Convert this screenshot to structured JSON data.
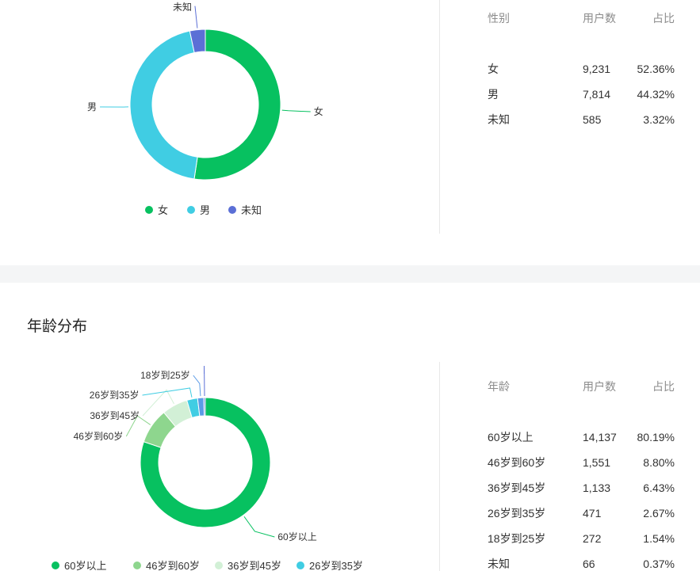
{
  "gender": {
    "table": {
      "headers": [
        "性别",
        "用户数",
        "占比"
      ],
      "rows": [
        {
          "label": "女",
          "users": "9,231",
          "pct": "52.36%"
        },
        {
          "label": "男",
          "users": "7,814",
          "pct": "44.32%"
        },
        {
          "label": "未知",
          "users": "585",
          "pct": "3.32%"
        }
      ]
    }
  },
  "age": {
    "title": "年龄分布",
    "table": {
      "headers": [
        "年龄",
        "用户数",
        "占比"
      ],
      "rows": [
        {
          "label": "60岁以上",
          "users": "14,137",
          "pct": "80.19%"
        },
        {
          "label": "46岁到60岁",
          "users": "1,551",
          "pct": "8.80%"
        },
        {
          "label": "36岁到45岁",
          "users": "1,133",
          "pct": "6.43%"
        },
        {
          "label": "26岁到35岁",
          "users": "471",
          "pct": "2.67%"
        },
        {
          "label": "18岁到25岁",
          "users": "272",
          "pct": "1.54%"
        },
        {
          "label": "未知",
          "users": "66",
          "pct": "0.37%"
        }
      ]
    }
  },
  "chart_data": [
    {
      "type": "pie",
      "title": "",
      "categories": [
        "女",
        "男",
        "未知"
      ],
      "values": [
        9231,
        7814,
        585
      ],
      "colors": [
        "#07c160",
        "#40cde3",
        "#5b6fd6"
      ],
      "legend": "bottom-center",
      "legend_items": [
        "女",
        "男",
        "未知"
      ]
    },
    {
      "type": "pie",
      "title": "年龄分布",
      "categories": [
        "60岁以上",
        "46岁到60岁",
        "36岁到45岁",
        "26岁到35岁",
        "18岁到25岁",
        "未知"
      ],
      "values": [
        14137,
        1551,
        1133,
        471,
        272,
        66
      ],
      "colors": [
        "#07c160",
        "#8ed68e",
        "#d2f0d6",
        "#40cde3",
        "#5b9be6",
        "#5b6fd6"
      ],
      "legend": "bottom-center",
      "legend_items": [
        "60岁以上",
        "46岁到60岁",
        "36岁到45岁",
        "26岁到35岁"
      ]
    }
  ]
}
